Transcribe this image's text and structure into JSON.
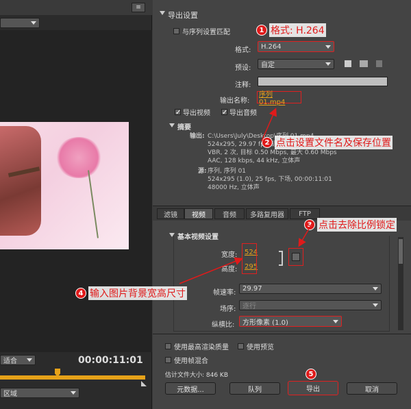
{
  "export_settings_title": "导出设置",
  "match_sequence_label": "与序列设置匹配",
  "format_label": "格式:",
  "format_value": "H.264",
  "preset_label": "预设:",
  "preset_value": "自定",
  "comment_label": "注释:",
  "output_name_label": "输出名称:",
  "output_name_value": "序列 01.mp4",
  "export_video_label": "导出视频",
  "export_audio_label": "导出音频",
  "summary_title": "摘要",
  "output_label": "输出:",
  "output_lines": [
    "C:\\Users\\July\\Desktop\\序列 01.mp4",
    "524x295, 29.97 fps, 逐行, 00:00:11:01",
    "VBR, 2 次, 目标 0.50 Mbps, 最大 0.60 Mbps",
    "AAC, 128 kbps, 44 kHz, 立体声"
  ],
  "source_label": "源:",
  "source_lines": [
    "序列, 序列 01",
    "524x295 (1.0), 25 fps, 下场, 00:00:11:01",
    "48000 Hz, 立体声"
  ],
  "tabs": [
    "滤镜",
    "视频",
    "音频",
    "多路复用器",
    "FTP"
  ],
  "basic_video_title": "基本视频设置",
  "width_label": "宽度:",
  "width_value": "524",
  "height_label": "高度:",
  "height_value": "295",
  "frame_rate_label": "帧速率:",
  "frame_rate_value": "29.97",
  "field_order_label": "场序:",
  "field_order_value": "逐行",
  "aspect_label": "纵横比:",
  "aspect_value": "方形像素 (1.0)",
  "max_render_label": "使用最高渲染质量",
  "use_preview_label": "使用预览",
  "frame_blend_label": "使用帧混合",
  "est_size_label": "估计文件大小: 846 KB",
  "buttons": {
    "metadata": "元数据...",
    "queue": "队列",
    "export": "导出",
    "cancel": "取消"
  },
  "left": {
    "fit": "适合",
    "timecode": "00:00:11:01",
    "area": "区域"
  },
  "callouts": {
    "c1": "格式: H.264",
    "c2": "点击设置文件名及保存位置",
    "c3": "点击去除比例锁定",
    "c4": "输入图片背景宽高尺寸"
  },
  "numbers": [
    "1",
    "2",
    "3",
    "4",
    "5"
  ],
  "colors": {
    "accent": "#e6a219",
    "annotation": "#e01a1a"
  }
}
